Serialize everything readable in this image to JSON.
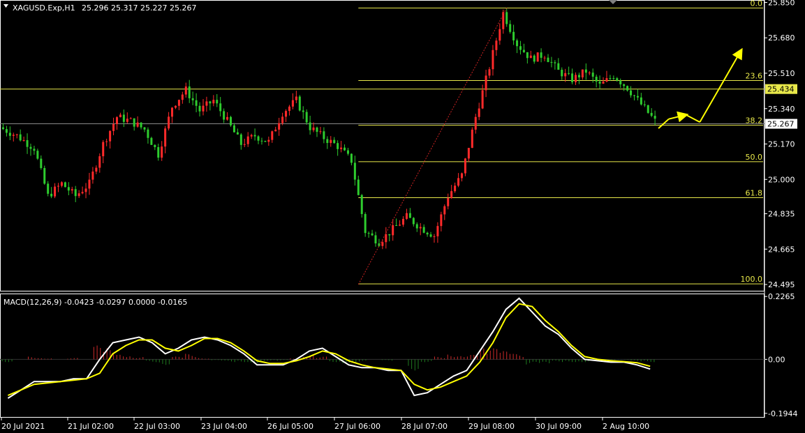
{
  "header": {
    "symbol": "XAGUSD.Exp,H1",
    "ohlc": "25.296 25.317 25.227 25.267",
    "macd_label": "MACD(12,26,9) -0.0423 -0.0297 0.0000 -0.0165"
  },
  "colors": {
    "background": "#000000",
    "bull": "#ff2a2a",
    "bear": "#2ecc2e",
    "fib": "#e8e84a",
    "signal": "#ffff00",
    "macd_line": "#ffffff",
    "hist_pos": "#cc2a2a",
    "hist_neg": "#1f7a1f",
    "arrow": "#ffff00"
  },
  "icons": {
    "menu": "triangle-down-icon"
  },
  "chart_data": [
    {
      "type": "candlestick",
      "x_labels": [
        "20 Jul 2021",
        "21 Jul 02:00",
        "22 Jul 03:00",
        "23 Jul 04:00",
        "26 Jul 05:00",
        "27 Jul 06:00",
        "28 Jul 07:00",
        "29 Jul 08:00",
        "30 Jul 09:00",
        "2 Aug 10:00"
      ],
      "y_ticks": [
        "25.850",
        "25.680",
        "25.510",
        "25.340",
        "25.170",
        "25.000",
        "24.835",
        "24.665",
        "24.495"
      ],
      "ylim": [
        24.475,
        25.855
      ],
      "price_tags": [
        {
          "label": "25.434",
          "value": 25.434,
          "style": "yellow"
        },
        {
          "label": "25.267",
          "value": 25.267,
          "style": "white"
        }
      ],
      "fib_levels": [
        {
          "label": "0.0",
          "value": 25.823
        },
        {
          "label": "23.6",
          "value": 25.475
        },
        {
          "label": "38.2",
          "value": 25.26
        },
        {
          "label": "50.0",
          "value": 25.085
        },
        {
          "label": "61.8",
          "value": 24.912
        },
        {
          "label": "100.0",
          "value": 24.365
        }
      ],
      "horizontal_lines": [
        25.434,
        25.267
      ],
      "path_points": [
        [
          0,
          25.25
        ],
        [
          5,
          25.21
        ],
        [
          10,
          25.15
        ],
        [
          14,
          24.92
        ],
        [
          18,
          24.98
        ],
        [
          22,
          24.92
        ],
        [
          26,
          24.98
        ],
        [
          30,
          25.17
        ],
        [
          34,
          25.3
        ],
        [
          38,
          25.28
        ],
        [
          42,
          25.24
        ],
        [
          46,
          25.12
        ],
        [
          50,
          25.35
        ],
        [
          54,
          25.43
        ],
        [
          58,
          25.33
        ],
        [
          62,
          25.38
        ],
        [
          66,
          25.28
        ],
        [
          70,
          25.17
        ],
        [
          74,
          25.21
        ],
        [
          78,
          25.18
        ],
        [
          82,
          25.32
        ],
        [
          86,
          25.38
        ],
        [
          90,
          25.25
        ],
        [
          94,
          25.2
        ],
        [
          98,
          25.16
        ],
        [
          102,
          25.09
        ],
        [
          106,
          24.75
        ],
        [
          110,
          24.7
        ],
        [
          114,
          24.76
        ],
        [
          118,
          24.82
        ],
        [
          122,
          24.77
        ],
        [
          126,
          24.73
        ],
        [
          130,
          24.92
        ],
        [
          134,
          25.02
        ],
        [
          138,
          25.3
        ],
        [
          142,
          25.54
        ],
        [
          146,
          25.8
        ],
        [
          150,
          25.65
        ],
        [
          154,
          25.58
        ],
        [
          158,
          25.6
        ],
        [
          162,
          25.52
        ],
        [
          166,
          25.48
        ],
        [
          170,
          25.52
        ],
        [
          174,
          25.45
        ],
        [
          178,
          25.5
        ],
        [
          182,
          25.44
        ],
        [
          186,
          25.36
        ],
        [
          190,
          25.28
        ]
      ],
      "dotted_line": {
        "from": [
          103,
          24.495
        ],
        "to": [
          146,
          25.823
        ]
      },
      "arrows": [
        {
          "from": [
            190,
            25.245
          ],
          "to": [
            193,
            25.29
          ]
        },
        {
          "from": [
            193,
            25.29
          ],
          "to": [
            198,
            25.31
          ]
        },
        {
          "from": [
            198,
            25.31
          ],
          "to": [
            202,
            25.275
          ]
        },
        {
          "from": [
            202,
            25.275
          ],
          "to": [
            214,
            25.62
          ]
        }
      ]
    },
    {
      "type": "line",
      "title": "MACD(12,26,9) -0.0423 -0.0297 0.0000 -0.0165",
      "y_ticks": [
        "0.2265",
        "0.00",
        "-0.1944"
      ],
      "ylim": [
        -0.205,
        0.232
      ],
      "series": [
        {
          "values": [
            -0.14,
            -0.11,
            -0.08,
            -0.08,
            -0.08,
            -0.07,
            -0.07,
            0.0,
            0.06,
            0.07,
            0.08,
            0.06,
            0.02,
            0.04,
            0.07,
            0.08,
            0.07,
            0.05,
            0.02,
            -0.02,
            -0.02,
            -0.02,
            0.0,
            0.03,
            0.04,
            0.01,
            -0.02,
            -0.03,
            -0.03,
            -0.04,
            -0.04,
            -0.13,
            -0.12,
            -0.09,
            -0.06,
            -0.04,
            0.03,
            0.1,
            0.18,
            0.22,
            0.17,
            0.12,
            0.09,
            0.04,
            -0.0,
            -0.005,
            -0.01,
            -0.01,
            -0.02,
            -0.035
          ]
        },
        {
          "values": [
            -0.13,
            -0.11,
            -0.09,
            -0.085,
            -0.08,
            -0.075,
            -0.07,
            -0.05,
            0.02,
            0.05,
            0.07,
            0.07,
            0.04,
            0.03,
            0.05,
            0.075,
            0.075,
            0.06,
            0.03,
            -0.005,
            -0.015,
            -0.015,
            -0.005,
            0.01,
            0.03,
            0.02,
            -0.005,
            -0.02,
            -0.03,
            -0.035,
            -0.04,
            -0.09,
            -0.11,
            -0.1,
            -0.08,
            -0.06,
            -0.01,
            0.06,
            0.15,
            0.2,
            0.19,
            0.14,
            0.1,
            0.05,
            0.01,
            0.0,
            -0.005,
            -0.008,
            -0.012,
            -0.025
          ]
        }
      ],
      "histogram": [
        -0.01,
        0.0,
        0.01,
        0.005,
        0.0,
        0.005,
        0.0,
        0.05,
        0.04,
        0.02,
        0.01,
        -0.01,
        -0.02,
        0.01,
        0.02,
        0.005,
        -0.005,
        -0.01,
        -0.01,
        -0.015,
        -0.005,
        -0.005,
        0.005,
        0.02,
        0.01,
        -0.01,
        -0.015,
        -0.01,
        0.0,
        -0.005,
        0.0,
        -0.04,
        -0.01,
        0.01,
        0.02,
        0.02,
        0.04,
        0.04,
        0.03,
        0.02,
        -0.02,
        -0.02,
        -0.01,
        -0.01,
        -0.01,
        -0.005,
        -0.005,
        -0.002,
        -0.008,
        -0.01
      ]
    }
  ]
}
